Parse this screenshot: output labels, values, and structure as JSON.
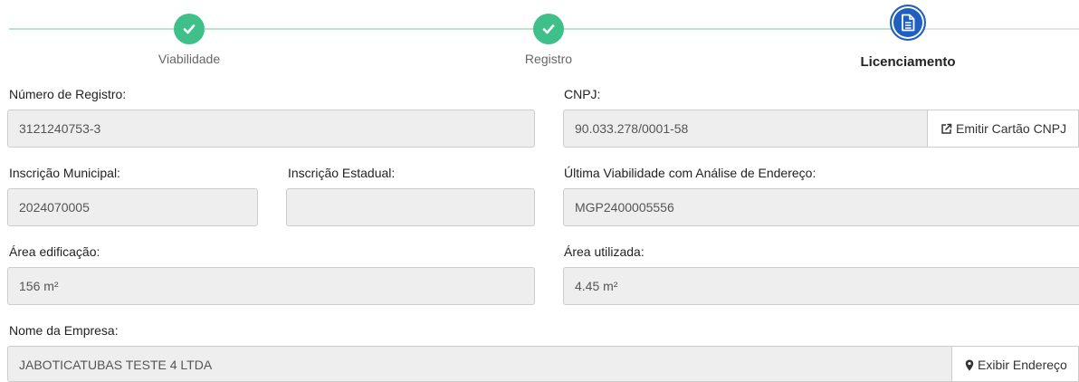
{
  "wizard": {
    "steps": [
      {
        "label": "Viabilidade",
        "status": "done",
        "icon": "check-icon"
      },
      {
        "label": "Registro",
        "status": "done",
        "icon": "check-icon"
      },
      {
        "label": "Licenciamento",
        "status": "current",
        "icon": "document-icon"
      }
    ],
    "colors": {
      "done": "#3fbf8a",
      "current": "#1f5fbf",
      "track": "#b9e4d0"
    }
  },
  "form": {
    "numero_registro": {
      "label": "Número de Registro:",
      "value": "3121240753-3"
    },
    "cnpj": {
      "label": "CNPJ:",
      "value": "90.033.278/0001-58",
      "button": "Emitir Cartão CNPJ",
      "button_icon": "external-link-icon"
    },
    "inscricao_municipal": {
      "label": "Inscrição Municipal:",
      "value": "2024070005"
    },
    "inscricao_estadual": {
      "label": "Inscrição Estadual:",
      "value": ""
    },
    "ultima_viabilidade": {
      "label": "Última Viabilidade com Análise de Endereço:",
      "value": "MGP2400005556"
    },
    "area_edificacao": {
      "label": "Área edificação:",
      "value": "156 m²"
    },
    "area_utilizada": {
      "label": "Área utilizada:",
      "value": "4.45 m²"
    },
    "nome_empresa": {
      "label": "Nome da Empresa:",
      "value": "JABOTICATUBAS TESTE 4 LTDA",
      "button": "Exibir Endereço",
      "button_icon": "map-marker-icon"
    }
  }
}
